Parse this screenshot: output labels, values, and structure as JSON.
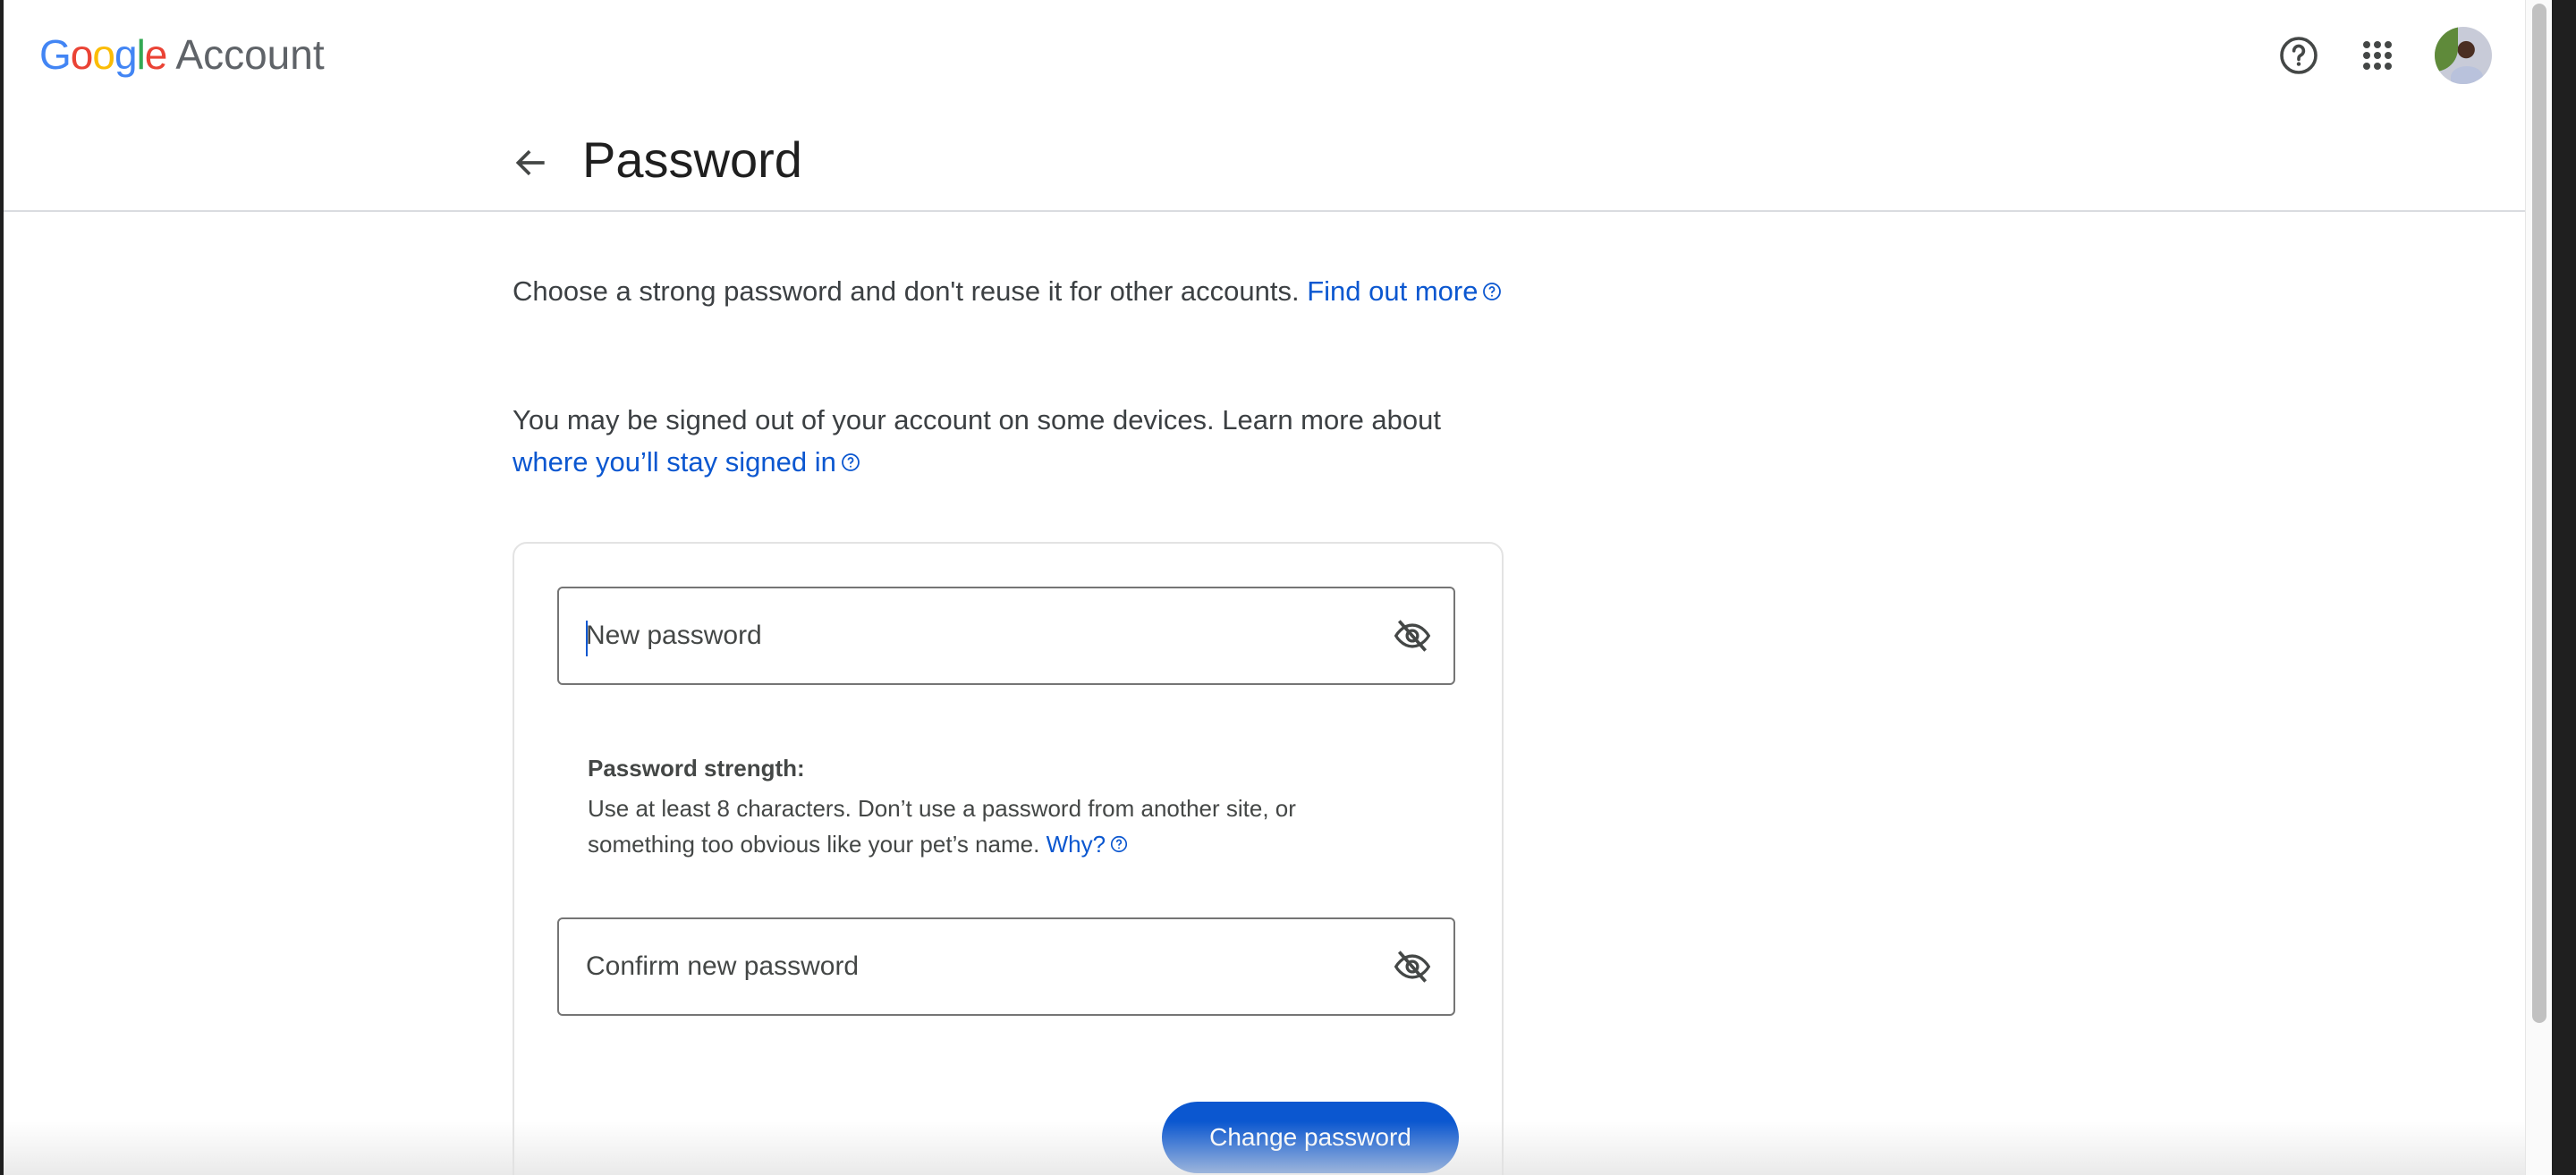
{
  "header": {
    "logo_google": "Google",
    "logo_account": "Account",
    "help_label": "Help",
    "apps_label": "Google apps"
  },
  "page": {
    "title": "Password"
  },
  "intro": {
    "text1": "Choose a strong password and don't reuse it for other accounts. ",
    "link1": "Find out more",
    "text2": "You may be signed out of your account on some devices. Learn more about ",
    "link2": "where you’ll stay signed in"
  },
  "form": {
    "new_password_placeholder": "New password",
    "new_password_value": "",
    "strength_label": "Password strength:",
    "strength_help": "Use at least 8 characters. Don’t use a password from another site, or something too obvious like your pet’s name. ",
    "why_link": "Why?",
    "confirm_password_placeholder": "Confirm new password",
    "confirm_password_value": "",
    "submit_label": "Change password"
  },
  "colors": {
    "accent": "#0b57d0",
    "text": "#1f1f1f"
  }
}
